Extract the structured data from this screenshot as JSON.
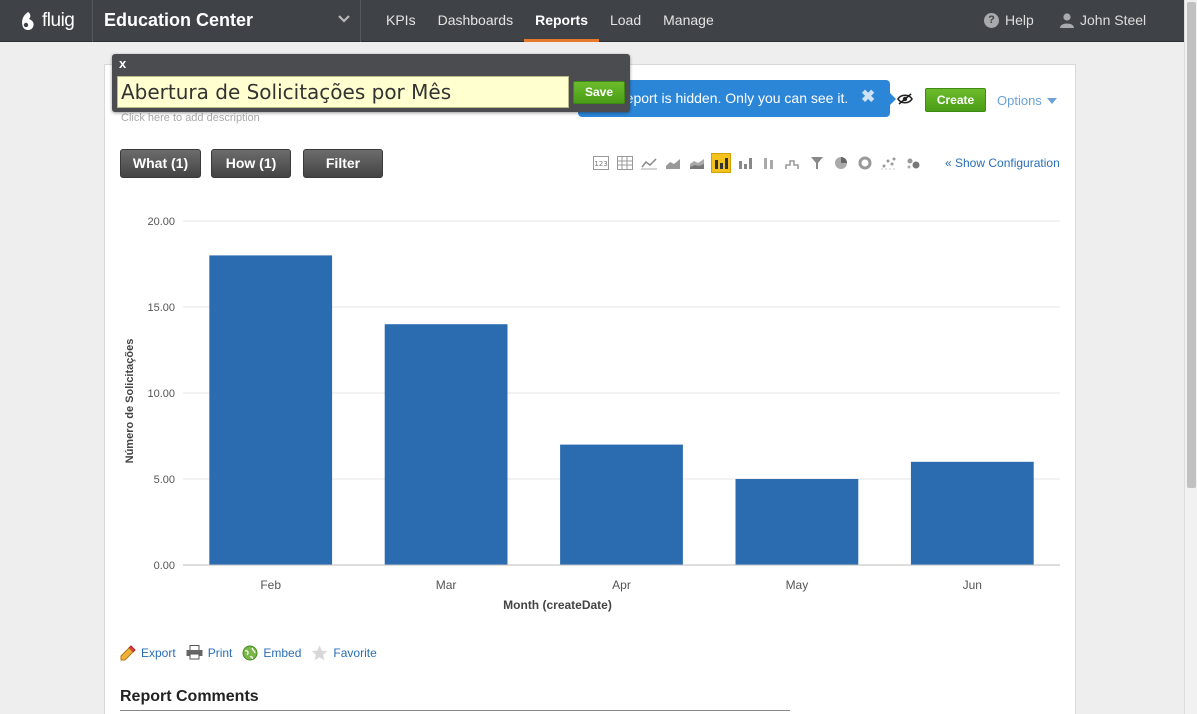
{
  "nav": {
    "logo": "fluig",
    "context": "Education Center",
    "items": [
      {
        "label": "KPIs",
        "active": false
      },
      {
        "label": "Dashboards",
        "active": false
      },
      {
        "label": "Reports",
        "active": true
      },
      {
        "label": "Load",
        "active": false
      },
      {
        "label": "Manage",
        "active": false
      }
    ],
    "help": "Help",
    "user": "John Steel"
  },
  "editor": {
    "close": "x",
    "title_value": "Abertura de Solicitações por Mês",
    "save": "Save",
    "description_hint": "Click here to add description"
  },
  "notice": {
    "text": "report is hidden. Only you can see it.",
    "close": "✖"
  },
  "toolbar": {
    "create": "Create",
    "options": "Options",
    "what": "What (1)",
    "how": "How (1)",
    "filter": "Filter",
    "show_config": "« Show Configuration",
    "chart_types": [
      "number-icon",
      "table-icon",
      "line-icon",
      "area-icon",
      "stacked-area-icon",
      "bar-icon",
      "stacked-bar-icon",
      "column-icon",
      "step-icon",
      "funnel-icon",
      "pie-icon",
      "donut-icon",
      "scatter-icon",
      "bubble-icon"
    ],
    "active_chart_type": "bar-icon"
  },
  "chart_data": {
    "type": "bar",
    "categories": [
      "Feb",
      "Mar",
      "Apr",
      "May",
      "Jun"
    ],
    "values": [
      18,
      14,
      7,
      5,
      6
    ],
    "xlabel": "Month (createDate)",
    "ylabel": "Número de Solicitações",
    "ylim": [
      0,
      20
    ],
    "yticks": [
      "0.00",
      "5.00",
      "10.00",
      "15.00",
      "20.00"
    ],
    "grid": true,
    "bar_color": "#2b6cb0"
  },
  "actions": {
    "export": "Export",
    "print": "Print",
    "embed": "Embed",
    "favorite": "Favorite"
  },
  "comments": {
    "title": "Report Comments"
  },
  "colors": {
    "accent": "#e8792b",
    "green": "#4a9d16",
    "notice": "#2c86d8",
    "link": "#2a6eb5"
  }
}
